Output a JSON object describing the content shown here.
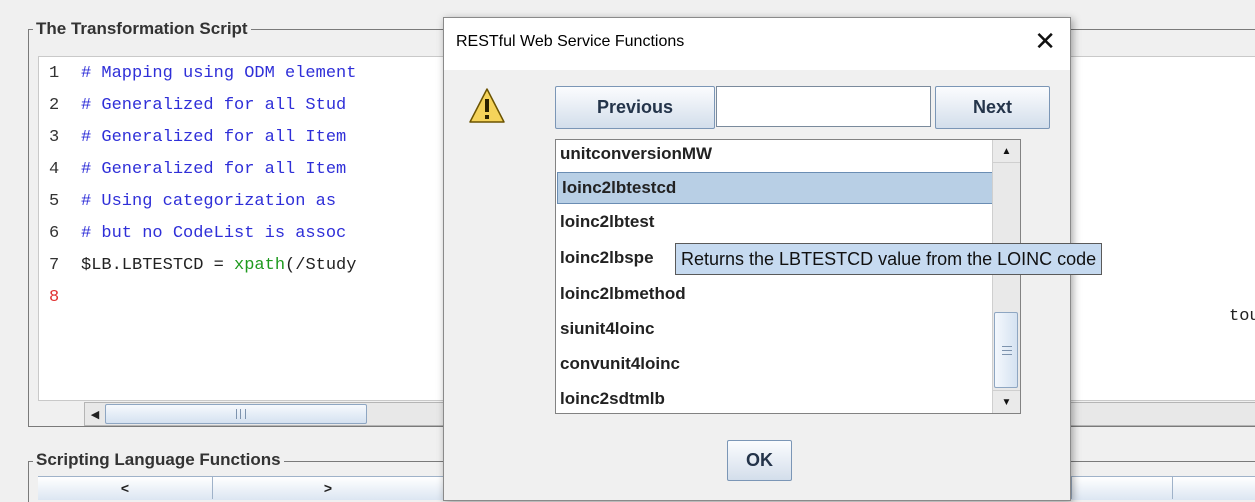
{
  "panel": {
    "title": "The Transformation Script",
    "line_numbers": [
      "1",
      "2",
      "3",
      "4",
      "5",
      "6",
      "7",
      "8"
    ],
    "code_lines": [
      "# Mapping using ODM element",
      "# Generalized for all Stud",
      "# Generalized for all Item",
      "# Generalized for all Item",
      "# Using categorization as",
      "# but no CodeList is assoc",
      "$LB.LBTESTCD = ",
      ""
    ],
    "line7_function": "xpath",
    "line7_rest": "(/Study",
    "right_overflow_text": "tou"
  },
  "functions_panel": {
    "title": "Scripting Language Functions",
    "prev_label": "<",
    "next_label": ">"
  },
  "dialog": {
    "title": "RESTful Web Service Functions",
    "close_glyph": "✕",
    "previous_label": "Previous",
    "next_label": "Next",
    "search_value": "",
    "items": [
      "unitconversionMW",
      "loinc2lbtestcd",
      "loinc2lbtest",
      "loinc2lbspe",
      "loinc2lbmethod",
      "siunit4loinc",
      "convunit4loinc",
      "loinc2sdtmlb"
    ],
    "selected_item": "loinc2lbtestcd",
    "tooltip": "Returns the LBTESTCD value from the LOINC code",
    "ok_label": "OK"
  },
  "icons": {
    "warning": "warning-icon",
    "close": "close-icon",
    "scroll_up": "scroll-up-icon",
    "scroll_down": "scroll-down-icon",
    "scroll_left": "scroll-left-icon"
  },
  "colors": {
    "comment": "#2f2fd8",
    "function": "#1e9a1e",
    "active_line": "#e03030",
    "selection": "#b8cfe5",
    "tooltip_bg": "#c6daf0"
  }
}
